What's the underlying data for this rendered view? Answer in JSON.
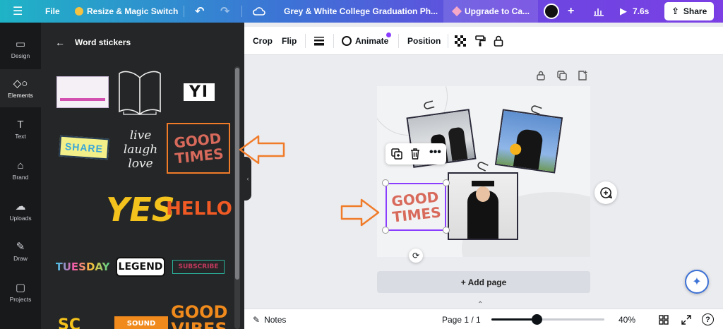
{
  "topbar": {
    "menu_icon": "hamburger-icon",
    "file_label": "File",
    "resize_label": "Resize & Magic Switch",
    "doc_title": "Grey & White College Graduation Ph...",
    "upgrade_label": "Upgrade to Ca...",
    "timer_label": "7.6s",
    "share_label": "Share"
  },
  "rail": {
    "items": [
      {
        "label": "Design",
        "icon": "layout-icon"
      },
      {
        "label": "Elements",
        "icon": "shapes-icon"
      },
      {
        "label": "Text",
        "icon": "text-icon"
      },
      {
        "label": "Brand",
        "icon": "brand-icon"
      },
      {
        "label": "Uploads",
        "icon": "cloud-upload-icon"
      },
      {
        "label": "Draw",
        "icon": "pen-icon"
      },
      {
        "label": "Projects",
        "icon": "folder-icon"
      }
    ]
  },
  "panel": {
    "title": "Word stickers",
    "stickers": [
      "YI",
      "SHARE",
      "live laugh love",
      "GOOD TIMES",
      "YES",
      "HELLO",
      "TUESDAY",
      "LEGEND",
      "SUBSCRIBE",
      "SC",
      "SOUND",
      "GOOD VIBES"
    ]
  },
  "toolbar": {
    "crop": "Crop",
    "flip": "Flip",
    "animate": "Animate",
    "position": "Position"
  },
  "canvas": {
    "selected_sticker": "GOOD TIMES",
    "add_page": "+ Add page",
    "accent": "#8b3dff",
    "arrow_color": "#f07c2a"
  },
  "bottombar": {
    "notes": "Notes",
    "page_indicator": "Page 1 / 1",
    "zoom": "40%",
    "zoom_fraction": 0.4
  }
}
